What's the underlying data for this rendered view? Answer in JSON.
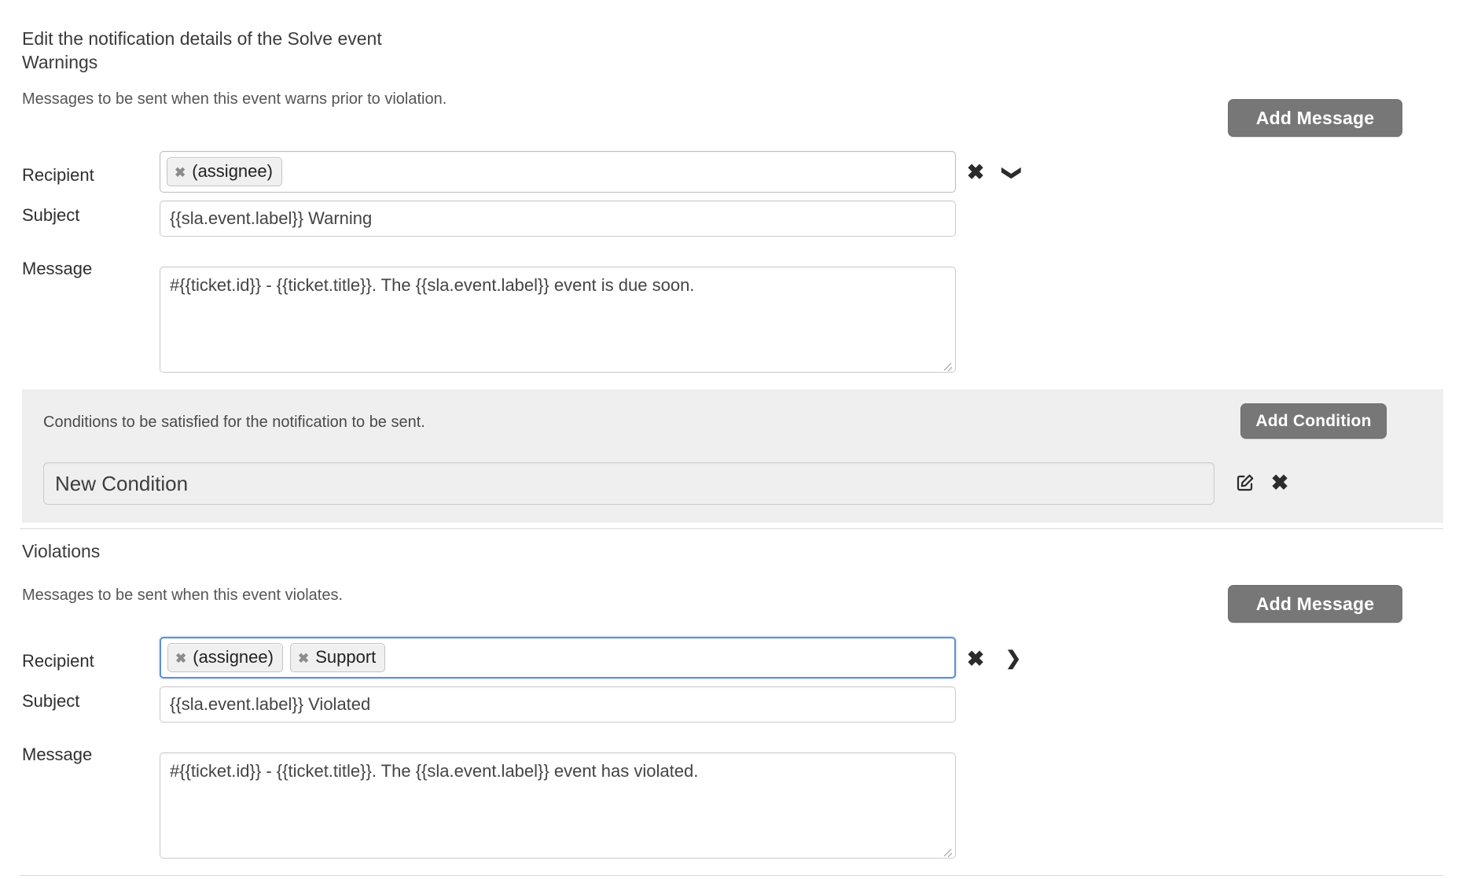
{
  "intro": "Edit the notification details of the Solve event",
  "warnings": {
    "title": "Warnings",
    "description": "Messages to be sent when this event warns prior to violation.",
    "add_message_label": "Add Message",
    "recipient_label": "Recipient",
    "recipient_tags": [
      "(assignee)"
    ],
    "subject_label": "Subject",
    "subject_value": "{{sla.event.label}} Warning",
    "message_label": "Message",
    "message_value": "#{{ticket.id}} - {{ticket.title}}.  The {{sla.event.label}} event is due soon.",
    "clear_icon": "✖",
    "expand_icon": "❯"
  },
  "conditions": {
    "description": "Conditions to be satisfied for the notification to be sent.",
    "add_condition_label": "Add Condition",
    "condition_name": "New Condition",
    "edit_icon": "edit-icon",
    "delete_icon": "✖"
  },
  "violations": {
    "title": "Violations",
    "description": "Messages to be sent when this event violates.",
    "add_message_label": "Add Message",
    "recipient_label": "Recipient",
    "recipient_tags": [
      "(assignee)",
      "Support"
    ],
    "subject_label": "Subject",
    "subject_value": "{{sla.event.label}} Violated",
    "message_label": "Message",
    "message_value": "#{{ticket.id}} - {{ticket.title}}.  The {{sla.event.label}} event has violated.",
    "clear_icon": "✖",
    "collapse_icon": "❯"
  },
  "tag_remove_icon": "✖",
  "colors": {
    "button_bg": "#777777",
    "panel_bg": "#efefef",
    "focus_border": "#5b8fd4",
    "text": "#333333"
  }
}
